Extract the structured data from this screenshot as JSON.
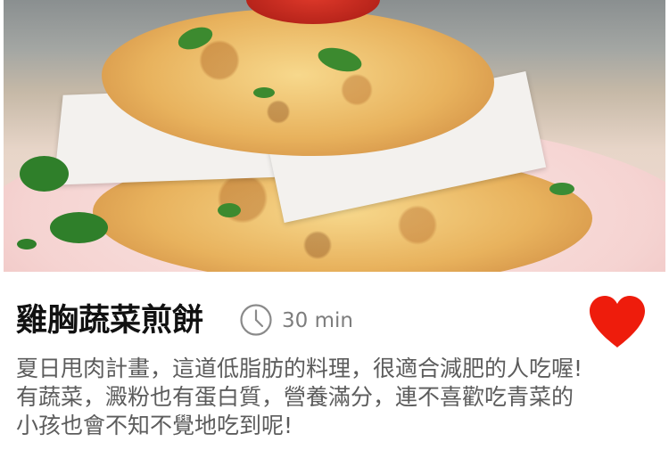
{
  "recipe": {
    "image_alt": "雞胸蔬菜煎餅",
    "title": "雞胸蔬菜煎餅",
    "duration": "30 min",
    "description_lines": [
      "夏日甩肉計畫，這道低脂肪的料理，很適合減肥的人吃喔!",
      "有蔬菜，澱粉也有蛋白質，營養滿分，連不喜歡吃青菜的",
      "小孩也會不知不覺地吃到呢!"
    ]
  },
  "icons": {
    "clock": "clock-icon",
    "favorite": "heart-icon"
  },
  "colors": {
    "favorite": "#ee1c0c",
    "title": "#111111",
    "muted": "#7d7d7d",
    "description": "#5c5c5c"
  }
}
